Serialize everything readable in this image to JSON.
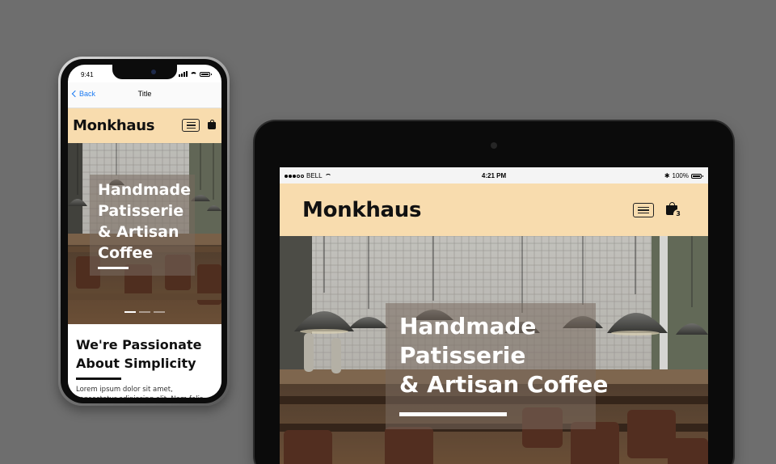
{
  "phone": {
    "status": {
      "time": "9:41"
    },
    "nav": {
      "back_label": "Back",
      "title": "Title"
    },
    "header": {
      "logo": "Monkhaus"
    },
    "hero": {
      "lines": [
        "Handmade",
        "Patisserie",
        "& Artisan",
        "Coffee"
      ],
      "active_slide": 1,
      "slide_count": 3
    },
    "section": {
      "heading_lines": [
        "We're Passionate",
        "About Simplicity"
      ],
      "body": "Lorem ipsum dolor sit amet, consectetur adipiscing elit. Nam felis elit, tincidunt ut"
    }
  },
  "tablet": {
    "status": {
      "carrier": "BELL",
      "time": "4:21 PM",
      "battery": "100%"
    },
    "header": {
      "logo": "Monkhaus",
      "cart_count": "3"
    },
    "hero": {
      "lines": [
        "Handmade",
        "Patisserie",
        "& Artisan Coffee"
      ]
    }
  },
  "colors": {
    "background": "#6e6e6e",
    "header": "#f8dcae",
    "ios_link": "#1d7bf2"
  },
  "icons": [
    "hamburger-menu-icon",
    "shopping-bag-icon",
    "back-chevron-icon",
    "wifi-icon",
    "battery-icon",
    "bluetooth-icon",
    "signal-bars-icon"
  ]
}
